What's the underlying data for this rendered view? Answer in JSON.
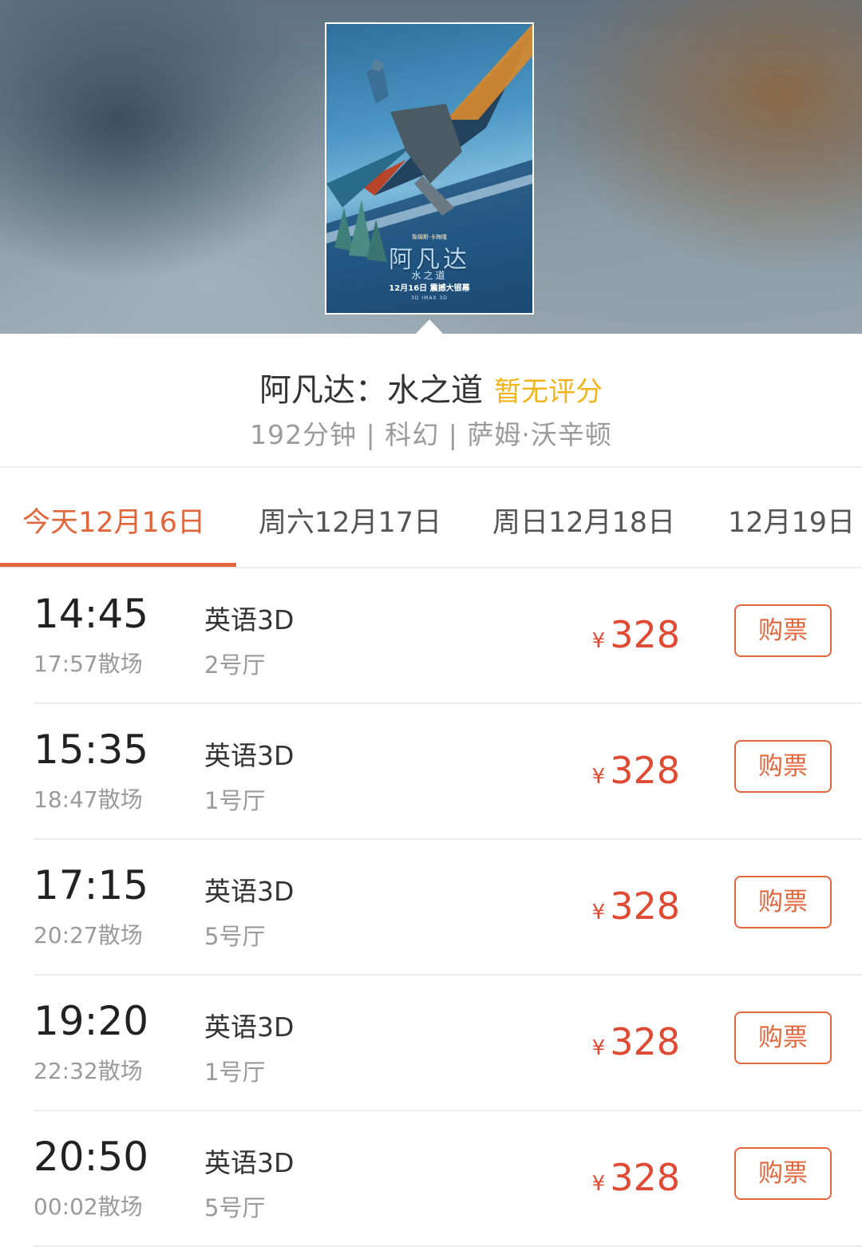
{
  "poster": {
    "credit": "詹姆斯·卡梅隆",
    "title": "阿凡达",
    "subtitle": "水之道",
    "release": "12月16日 震撼大银幕",
    "formats": "3D IMAX 3D"
  },
  "movie": {
    "title": "阿凡达：水之道",
    "rating": "暂无评分",
    "meta": "192分钟 | 科幻 | 萨姆·沃辛顿"
  },
  "tabs": [
    {
      "label": "今天12月16日"
    },
    {
      "label": "周六12月17日"
    },
    {
      "label": "周日12月18日"
    },
    {
      "label": "12月19日"
    }
  ],
  "showtimes": [
    {
      "start": "14:45",
      "end": "17:57散场",
      "lang": "英语3D",
      "hall": "2号厅",
      "currency": "¥",
      "price": "328",
      "buy": "购票"
    },
    {
      "start": "15:35",
      "end": "18:47散场",
      "lang": "英语3D",
      "hall": "1号厅",
      "currency": "¥",
      "price": "328",
      "buy": "购票"
    },
    {
      "start": "17:15",
      "end": "20:27散场",
      "lang": "英语3D",
      "hall": "5号厅",
      "currency": "¥",
      "price": "328",
      "buy": "购票"
    },
    {
      "start": "19:20",
      "end": "22:32散场",
      "lang": "英语3D",
      "hall": "1号厅",
      "currency": "¥",
      "price": "328",
      "buy": "购票"
    },
    {
      "start": "20:50",
      "end": "00:02散场",
      "lang": "英语3D",
      "hall": "5号厅",
      "currency": "¥",
      "price": "328",
      "buy": "购票"
    }
  ],
  "colors": {
    "accent": "#e2663c",
    "price": "#e04a33",
    "rating": "#f2b31b"
  }
}
